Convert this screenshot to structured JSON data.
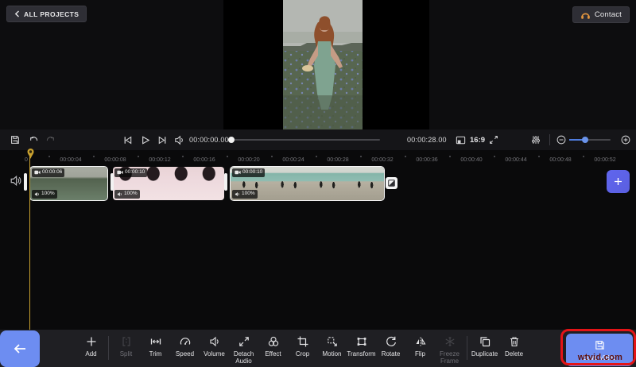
{
  "header": {
    "back_to_projects": "ALL PROJECTS",
    "contact": "Contact"
  },
  "transport": {
    "current_time": "00:00:00.00",
    "total_time": "00:00:28.00",
    "aspect_ratio": "16:9"
  },
  "timeline": {
    "ruler_labels": [
      "0",
      "00:00:04",
      "00:00:08",
      "00:00:12",
      "00:00:16",
      "00:00:20",
      "00:00:24",
      "00:00:28",
      "00:00:32",
      "00:00:36",
      "00:00:40",
      "00:00:44",
      "00:00:48",
      "00:00:52"
    ],
    "clips": [
      {
        "duration": "00:00:06",
        "volume": "100%",
        "selected": true,
        "theme": "field",
        "thumbs": 3,
        "content": "woman in green dress in flower field"
      },
      {
        "duration": "00:00:10",
        "volume": "100%",
        "selected": false,
        "theme": "pink",
        "thumbs": 4,
        "content": "woman in pink top"
      },
      {
        "duration": "00:00:10",
        "volume": "100%",
        "selected": true,
        "theme": "beach",
        "thumbs": 4,
        "content": "people standing on beach"
      }
    ]
  },
  "toolbar": {
    "items": [
      {
        "id": "add",
        "label": "Add",
        "icon": "plus",
        "disabled": false,
        "divider_after": true
      },
      {
        "id": "split",
        "label": "Split",
        "icon": "split",
        "disabled": true,
        "divider_after": false
      },
      {
        "id": "trim",
        "label": "Trim",
        "icon": "trim",
        "disabled": false,
        "divider_after": false
      },
      {
        "id": "speed",
        "label": "Speed",
        "icon": "speed",
        "disabled": false,
        "divider_after": false
      },
      {
        "id": "volume",
        "label": "Volume",
        "icon": "volume",
        "disabled": false,
        "divider_after": false
      },
      {
        "id": "detach-audio",
        "label": "Detach Audio",
        "icon": "detach",
        "disabled": false,
        "divider_after": false
      },
      {
        "id": "effect",
        "label": "Effect",
        "icon": "effect",
        "disabled": false,
        "divider_after": false
      },
      {
        "id": "crop",
        "label": "Crop",
        "icon": "crop",
        "disabled": false,
        "divider_after": false
      },
      {
        "id": "motion",
        "label": "Motion",
        "icon": "motion",
        "disabled": false,
        "divider_after": false
      },
      {
        "id": "transform",
        "label": "Transform",
        "icon": "transform",
        "disabled": false,
        "divider_after": false
      },
      {
        "id": "rotate",
        "label": "Rotate",
        "icon": "rotate",
        "disabled": false,
        "divider_after": false
      },
      {
        "id": "flip",
        "label": "Flip",
        "icon": "flip",
        "disabled": false,
        "divider_after": false
      },
      {
        "id": "freeze-frame",
        "label": "Freeze Frame",
        "icon": "freeze",
        "disabled": true,
        "divider_after": true
      },
      {
        "id": "duplicate",
        "label": "Duplicate",
        "icon": "duplicate",
        "disabled": false,
        "divider_after": false
      },
      {
        "id": "delete",
        "label": "Delete",
        "icon": "delete",
        "disabled": false,
        "divider_after": false
      }
    ],
    "save_video": "Save Video"
  },
  "watermark": "wtvid.com",
  "colors": {
    "accent_blue": "#6d8df1",
    "plus_button": "#5d64ec",
    "playhead": "#c9a12f",
    "annotation_red": "#e41417",
    "toolbar_bg": "#1f1f23"
  }
}
